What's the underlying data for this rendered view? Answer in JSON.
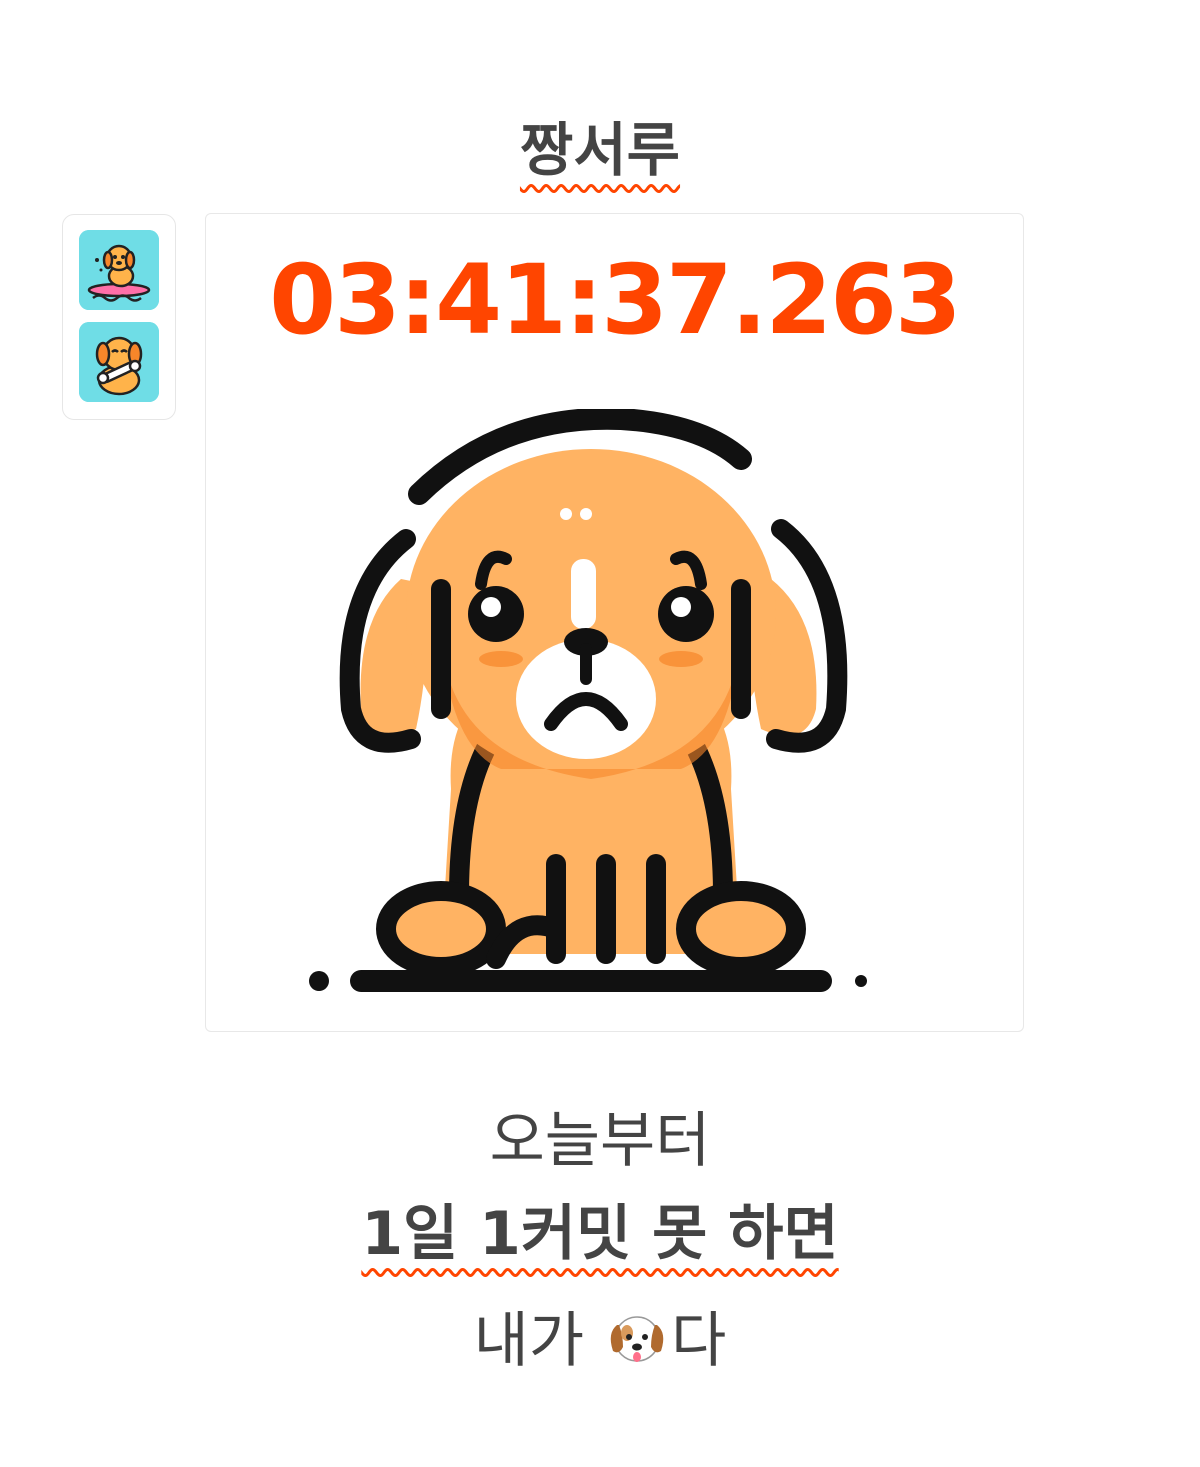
{
  "title": "짱서루",
  "side_buttons": [
    {
      "icon": "surfing-dog-icon"
    },
    {
      "icon": "dog-with-bone-icon"
    }
  ],
  "timer": "03:41:37.263",
  "image": {
    "icon": "sad-dog-illustration"
  },
  "message": {
    "line1": "오늘부터",
    "line2": "1일 1커밋 못 하면",
    "line3_prefix": "내가 ",
    "line3_emoji": "dog-face-icon",
    "line3_suffix": "다"
  },
  "colors": {
    "accent": "#ff4500",
    "text": "#444444",
    "dog_body": "#ffb363",
    "dog_shadow": "#f7862a",
    "icon_bg": "#6fdde6"
  }
}
